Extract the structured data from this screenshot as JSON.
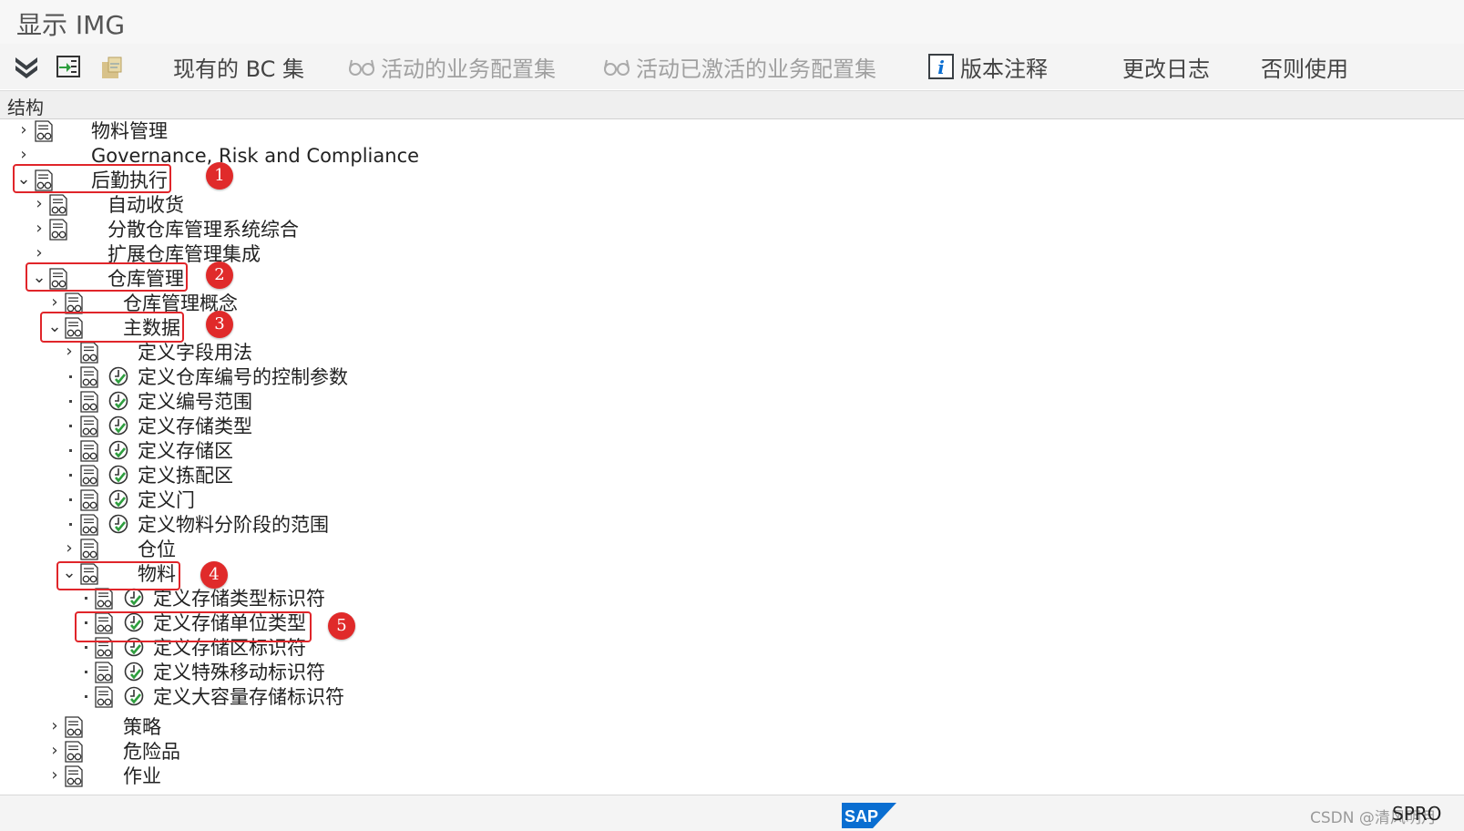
{
  "window": {
    "title": "显示 IMG"
  },
  "toolbar": {
    "current_bc_sets": "现有的 BC 集",
    "active_bc_sets": "活动的业务配置集",
    "activated_bc_sets": "活动已激活的业务配置集",
    "release_notes": "版本注释",
    "change_log": "更改日志",
    "where_used": "否则使用"
  },
  "structure_header": "结构",
  "tree": [
    "物料管理",
    "Governance, Risk and Compliance",
    "后勤执行",
    "自动收货",
    "分散仓库管理系统综合",
    "扩展仓库管理集成",
    "仓库管理",
    "仓库管理概念",
    "主数据",
    "定义字段用法",
    "定义仓库编号的控制参数",
    "定义编号范围",
    "定义存储类型",
    "定义存储区",
    "定义拣配区",
    "定义门",
    "定义物料分阶段的范围",
    "仓位",
    "物料",
    "定义存储类型标识符",
    "定义存储单位类型",
    "定义存储区标识符",
    "定义特殊移动标识符",
    "定义大容量存储标识符",
    "策略",
    "危险品",
    "作业"
  ],
  "markers": [
    "1",
    "2",
    "3",
    "4",
    "5"
  ],
  "status": {
    "sap_logo": "SAP",
    "watermark": "CSDN @清风明月",
    "transaction": "SPRO"
  },
  "colors": {
    "highlight_box": "#e0252a",
    "marker": "#e02a2a",
    "exec_icon": "#2e9e3e",
    "sap_blue": "#0a6ed1"
  }
}
